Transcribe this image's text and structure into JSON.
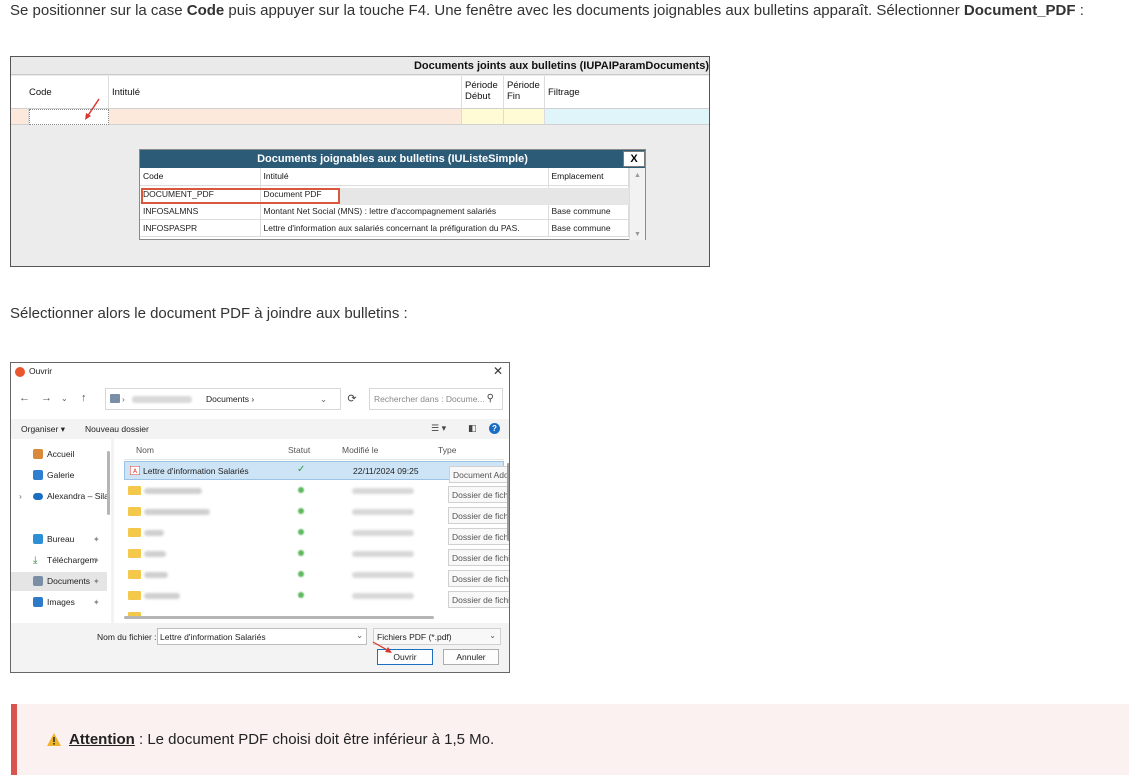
{
  "intro": {
    "part1": "Se positionner sur la case ",
    "bold1": "Code",
    "part2": " puis appuyer sur la touche F4. Une fenêtre avec les documents joignables aux bulletins apparaît. Sélectionner ",
    "bold2": "Document_PDF",
    "part3": " :"
  },
  "screenshot1": {
    "window_title": "Documents joints aux bulletins (IUPAIParamDocuments)",
    "columns": {
      "code": "Code",
      "intitule": "Intitulé",
      "periode_debut": "Période Début",
      "periode_fin": "Période Fin",
      "filtrage": "Filtrage"
    },
    "popup": {
      "title": "Documents joignables aux bulletins (IUListeSimple)",
      "close_label": "X",
      "headers": {
        "code": "Code",
        "intitule": "Intitulé",
        "emplacement": "Emplacement"
      },
      "rows": [
        {
          "code": "DOCUMENT_PDF",
          "intitule": "Document PDF",
          "emplacement": ""
        },
        {
          "code": "INFOSALMNS",
          "intitule": "Montant Net Social (MNS) : lettre d'accompagnement salariés",
          "emplacement": "Base commune"
        },
        {
          "code": "INFOSPASPR",
          "intitule": "Lettre d'information aux salariés concernant la préfiguration du PAS.",
          "emplacement": "Base commune"
        }
      ]
    },
    "colors": {
      "popup_title_bg": "#2c5b78",
      "highlight_border": "#d9583b",
      "row_peach": "#fde8dc",
      "row_yellow": "#fffbd4",
      "row_cyan": "#dff5fa"
    }
  },
  "middle_text": "Sélectionner alors le document PDF à joindre aux bulletins :",
  "screenshot2": {
    "window_title": "Ouvrir",
    "path_current": "Documents",
    "search_placeholder": "Rechercher dans : Docume...",
    "organize_label": "Organiser",
    "new_folder_label": "Nouveau dossier",
    "sidebar": [
      {
        "label": "Accueil",
        "icon": "home-icon",
        "pinned": false
      },
      {
        "label": "Galerie",
        "icon": "gallery-icon",
        "pinned": false
      },
      {
        "label": "Alexandra – Sila",
        "icon": "cloud-icon",
        "pinned": false
      },
      {
        "label": "Bureau",
        "icon": "desktop-icon",
        "pinned": true
      },
      {
        "label": "Téléchargem",
        "icon": "download-icon",
        "pinned": true
      },
      {
        "label": "Documents",
        "icon": "documents-icon",
        "pinned": true
      },
      {
        "label": "Images",
        "icon": "images-icon",
        "pinned": true
      }
    ],
    "columns": {
      "name": "Nom",
      "status": "Statut",
      "modified": "Modifié le",
      "type": "Type"
    },
    "selected_file": {
      "name": "Lettre d'information Salariés",
      "status": "✓",
      "date": "22/11/2024 09:25",
      "type": "Document Adobe"
    },
    "folder_type": "Dossier de fichiers",
    "filename_label": "Nom du fichier :",
    "filename_value": "Lettre d'information Salariés",
    "filetype_value": "Fichiers PDF (*.pdf)",
    "open_button": "Ouvrir",
    "cancel_button": "Annuler"
  },
  "attention": {
    "label": "Attention",
    "text": " : Le document PDF choisi doit être inférieur à 1,5 Mo.",
    "accent_color": "#d9534f"
  }
}
